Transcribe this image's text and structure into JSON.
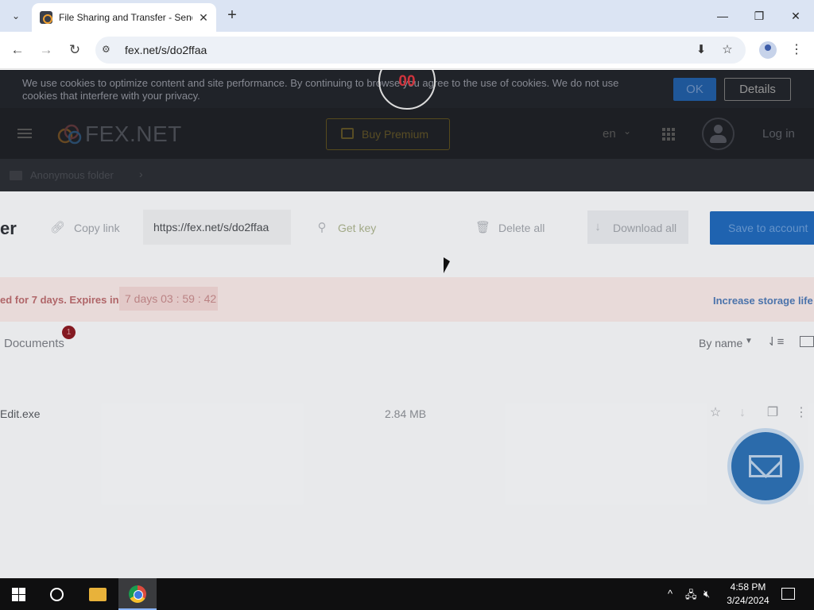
{
  "browser": {
    "tab_title": "File Sharing and Transfer - Send",
    "url": "fex.net/s/do2ffaa",
    "new_tab_symbol": "+",
    "close_symbol": "✕"
  },
  "cookie_banner": {
    "text": "We use cookies to optimize content and site performance. By continuing to browse you agree to the use of cookies. We do not use cookies that interfere with your privacy.",
    "ok_label": "OK",
    "details_label": "Details"
  },
  "timer_overlay": {
    "value": "00"
  },
  "header": {
    "logo_text": "FEX.NET",
    "buy_premium_label": "Buy Premium",
    "language": "en",
    "login_label": "Log in"
  },
  "breadcrumb": {
    "folder_label": "Anonymous folder"
  },
  "actions": {
    "folder_title_visible": "er",
    "copy_link_label": "Copy link",
    "share_url": "https://fex.net/s/do2ffaa",
    "get_key_label": "Get key",
    "delete_all_label": "Delete all",
    "download_all_label": "Download all",
    "save_to_account_label": "Save to account"
  },
  "expiry": {
    "text_visible": "ed for 7 days. Expires in",
    "countdown": "7 days  03 : 59 : 42",
    "increase_storage_label": "Increase storage life"
  },
  "listing": {
    "documents_tab_label": "Documents",
    "documents_count": "1",
    "sort_label": "By name",
    "files": [
      {
        "name": "Edit.exe",
        "size": "2.84 MB"
      }
    ]
  },
  "taskbar": {
    "time": "4:58 PM",
    "date": "3/24/2024"
  },
  "colors": {
    "accent_blue": "#1f67b8",
    "countdown_red": "#d9353f",
    "expire_bg": "#f3e4e3"
  }
}
